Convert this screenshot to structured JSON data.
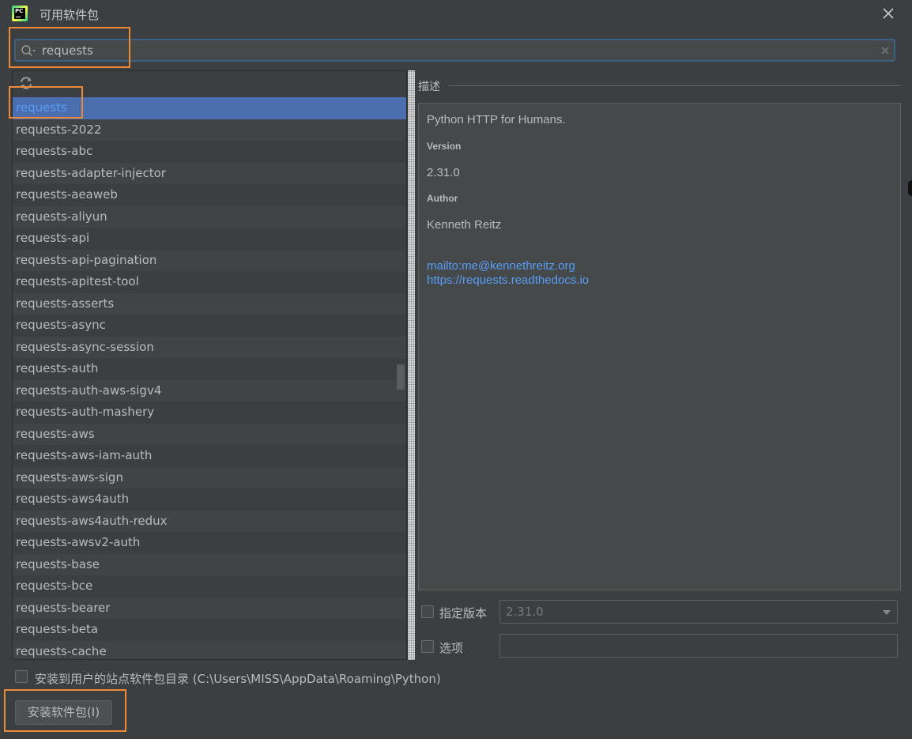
{
  "window": {
    "title": "可用软件包"
  },
  "search": {
    "value": "requests"
  },
  "packages": [
    "requests",
    "requests-2022",
    "requests-abc",
    "requests-adapter-injector",
    "requests-aeaweb",
    "requests-aliyun",
    "requests-api",
    "requests-api-pagination",
    "requests-apitest-tool",
    "requests-asserts",
    "requests-async",
    "requests-async-session",
    "requests-auth",
    "requests-auth-aws-sigv4",
    "requests-auth-mashery",
    "requests-aws",
    "requests-aws-iam-auth",
    "requests-aws-sign",
    "requests-aws4auth",
    "requests-aws4auth-redux",
    "requests-awsv2-auth",
    "requests-base",
    "requests-bce",
    "requests-bearer",
    "requests-beta",
    "requests-cache"
  ],
  "selected_index": 0,
  "description": {
    "section_title": "描述",
    "summary": "Python HTTP for Humans.",
    "version_label": "Version",
    "version": "2.31.0",
    "author_label": "Author",
    "author": "Kenneth Reitz",
    "email_link": "mailto:me@kennethreitz.org",
    "home_link": "https://requests.readthedocs.io"
  },
  "options": {
    "specify_version_label": "指定版本",
    "specify_version_value": "2.31.0",
    "options_label": "选项",
    "options_value": ""
  },
  "install_to_user_label": "安装到用户的站点软件包目录 (C:\\Users\\MISS\\AppData\\Roaming\\Python)",
  "install_button_label": "安装软件包(I)",
  "colors": {
    "background": "#3c3f41",
    "selection": "#4b6eaf",
    "link": "#589df6",
    "highlight": "#ec8a37",
    "focus_border": "#3d6185"
  },
  "icons": {
    "app": "pycharm-icon",
    "close": "close-icon",
    "search": "search-icon",
    "clear": "clear-icon",
    "refresh": "refresh-icon",
    "dropdown": "chevron-down-icon"
  }
}
